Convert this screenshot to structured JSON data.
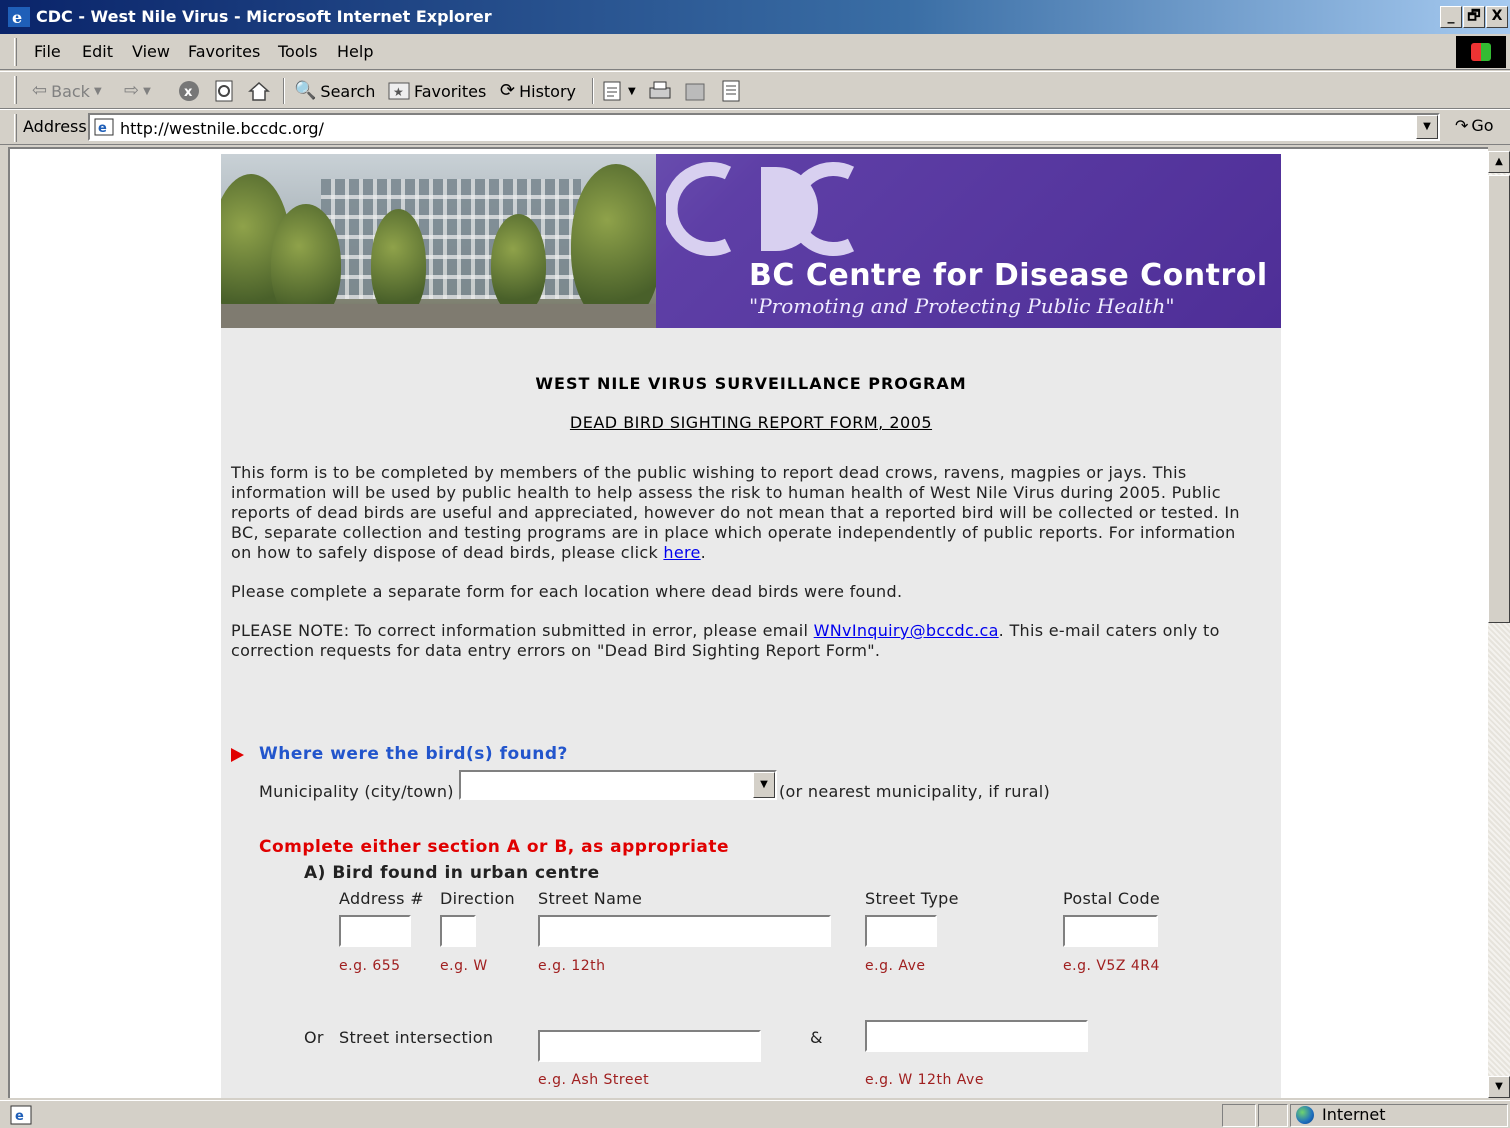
{
  "window": {
    "title": "CDC - West Nile Virus - Microsoft Internet Explorer",
    "min_label": "_",
    "restore_label": "🗗",
    "close_label": "X"
  },
  "menu": [
    "File",
    "Edit",
    "View",
    "Favorites",
    "Tools",
    "Help"
  ],
  "toolbar": {
    "back": "Back",
    "search": "Search",
    "favorites": "Favorites",
    "history": "History"
  },
  "address": {
    "label": "Address",
    "url": "http://westnile.bccdc.org/",
    "go": "Go"
  },
  "banner": {
    "logo_text": "CDC",
    "title": "BC Centre for Disease Control",
    "tagline": "\"Promoting and Protecting Public Health\""
  },
  "page": {
    "program_title": "WEST NILE VIRUS SURVEILLANCE PROGRAM",
    "form_title": "DEAD BIRD SIGHTING REPORT FORM, 2005",
    "intro": "This form is to be completed by members of the public wishing to report dead crows, ravens, magpies or jays. This information will be used by public health to help assess the risk to human health of West Nile Virus during 2005. Public reports of dead birds are useful and appreciated, however do not mean that a reported bird will be collected or tested. In BC, separate collection and testing programs are in place which operate independently of public reports. For information on how to safely dispose of dead birds, please click",
    "intro_link": "here",
    "intro_end": ".",
    "separate_form": "Please complete a separate form for each location where dead birds were found.",
    "note_start": "PLEASE NOTE: To correct information submitted in error, please email",
    "note_email": "WNvInquiry@bccdc.ca",
    "note_end": ". This e-mail caters only to correction requests for data entry errors on \"Dead Bird Sighting Report Form\"."
  },
  "form": {
    "question": "Where were the bird(s) found?",
    "municipality_label": "Municipality (city/town)",
    "municipality_value": "",
    "municipality_hint": "(or nearest municipality, if rural)",
    "section_note": "Complete either section A or B, as appropriate",
    "section_a": "A) Bird found in urban centre",
    "columns": {
      "address": "Address #",
      "direction": "Direction",
      "street_name": "Street Name",
      "street_type": "Street Type",
      "postal_code": "Postal Code"
    },
    "examples": {
      "address": "e.g. 655",
      "direction": "e.g. W",
      "street_name": "e.g. 12th",
      "street_type": "e.g. Ave",
      "postal_code": "e.g. V5Z 4R4",
      "intersection1": "e.g. Ash Street",
      "intersection2": "e.g. W 12th Ave"
    },
    "or_label": "Or",
    "intersection_label": "Street intersection",
    "amp": "&"
  },
  "status": {
    "zone": "Internet"
  }
}
